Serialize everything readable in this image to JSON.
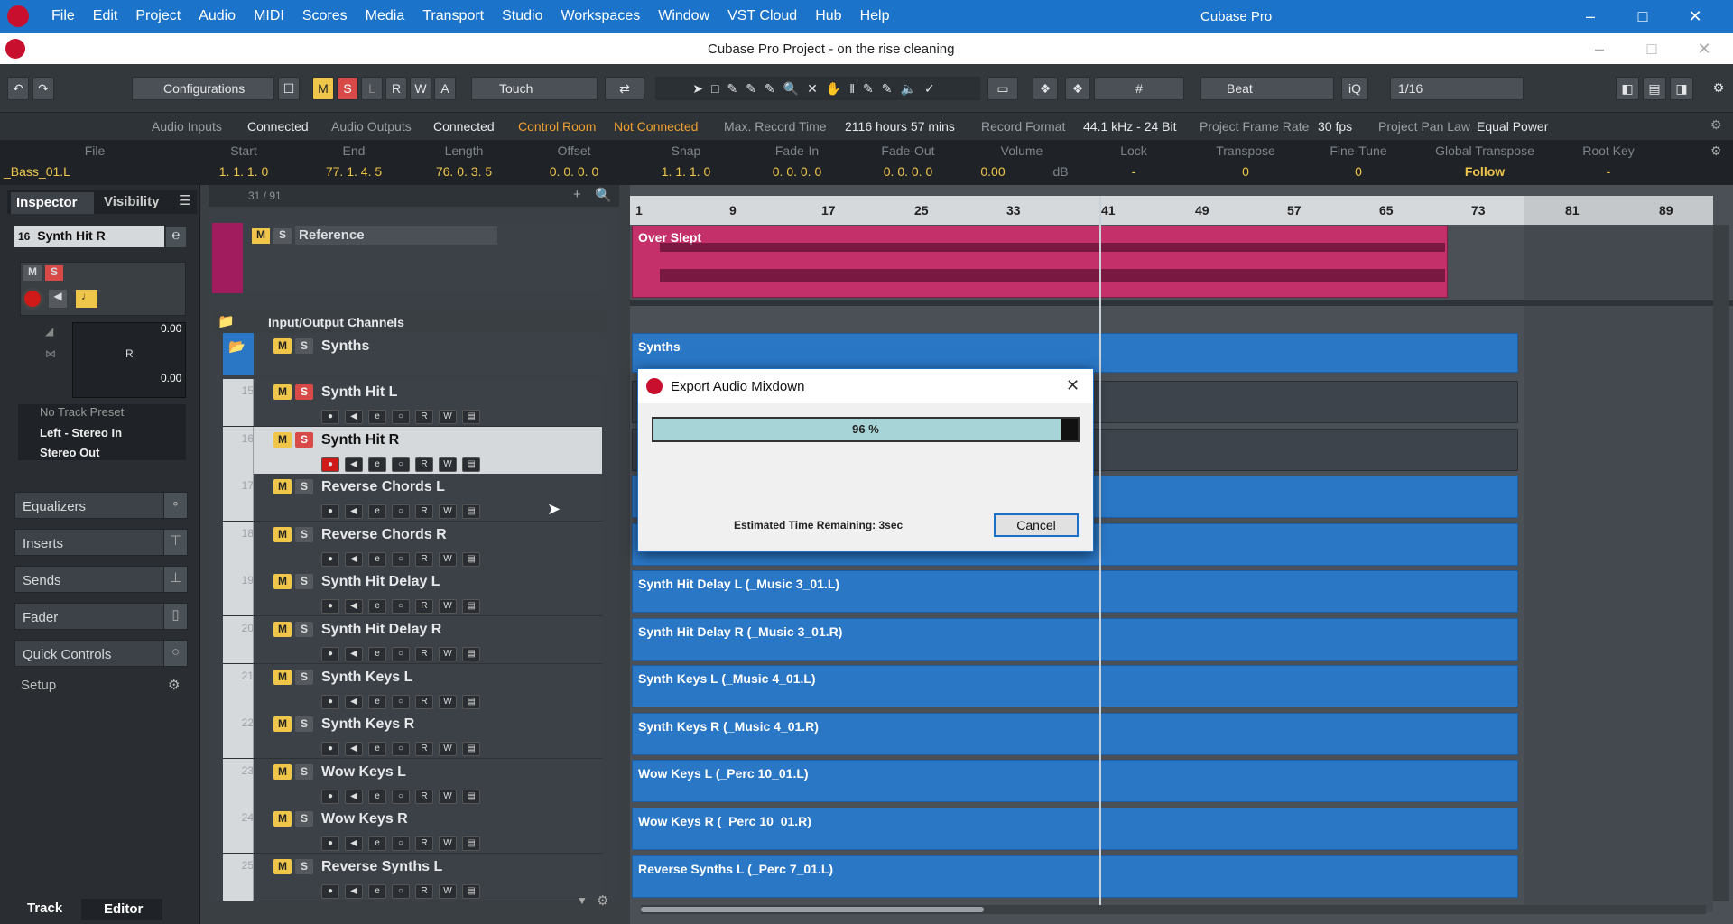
{
  "os": {
    "menu": [
      "File",
      "Edit",
      "Project",
      "Audio",
      "MIDI",
      "Scores",
      "Media",
      "Transport",
      "Studio",
      "Workspaces",
      "Window",
      "VST Cloud",
      "Hub",
      "Help"
    ],
    "app_title": "Cubase Pro"
  },
  "project": {
    "title": "Cubase Pro Project - on the rise cleaning"
  },
  "toolbar": {
    "configurations": "Configurations",
    "automation_mode": "Touch",
    "snap_type": "Beat",
    "quantize": "1/16",
    "iq": "iQ",
    "mode_buttons": [
      "M",
      "S",
      "L",
      "R",
      "W",
      "A"
    ]
  },
  "status": {
    "audio_inputs_label": "Audio Inputs",
    "audio_inputs_value": "Connected",
    "audio_outputs_label": "Audio Outputs",
    "audio_outputs_value": "Connected",
    "control_room_label": "Control Room",
    "control_room_value": "Not Connected",
    "max_record_label": "Max. Record Time",
    "max_record_value": "2116 hours 57 mins",
    "record_format_label": "Record Format",
    "record_format_value": "44.1 kHz - 24 Bit",
    "frame_rate_label": "Project Frame Rate",
    "frame_rate_value": "30 fps",
    "pan_law_label": "Project Pan Law",
    "pan_law_value": "Equal Power"
  },
  "infoline": {
    "headers": [
      "File",
      "Start",
      "End",
      "Length",
      "Offset",
      "Snap",
      "Fade-In",
      "Fade-Out",
      "Volume",
      "Lock",
      "Transpose",
      "Fine-Tune",
      "Global Transpose",
      "Root Key"
    ],
    "values": [
      "_Bass_01.L",
      "1. 1. 1.   0",
      "77. 1. 4.   5",
      "76. 0. 3.   5",
      "0. 0. 0.   0",
      "1. 1. 1.   0",
      "0. 0. 0.   0",
      "0. 0. 0.   0",
      "0.00",
      "-",
      "0",
      "0",
      "Follow",
      "-"
    ],
    "volume_unit": "dB"
  },
  "inspector": {
    "tab_inspector": "Inspector",
    "tab_visibility": "Visibility",
    "track_number": "16",
    "track_name": "Synth Hit R",
    "volume": "0.00",
    "pan_label": "R",
    "pan_value": "0.00",
    "preset": "No Track Preset",
    "input": "Left - Stereo In",
    "output": "Stereo Out",
    "sections": [
      "Equalizers",
      "Inserts",
      "Sends",
      "Fader",
      "Quick Controls"
    ],
    "setup": "Setup",
    "bottom_tab_track": "Track",
    "bottom_tab_editor": "Editor"
  },
  "tracklist": {
    "count": "31 / 91",
    "reference": "Reference",
    "folder": "Input/Output Channels",
    "synths": "Synths",
    "tracks": [
      {
        "num": "15",
        "name": "Synth Hit L",
        "solo": true
      },
      {
        "num": "16",
        "name": "Synth Hit R",
        "solo": true
      },
      {
        "num": "17",
        "name": "Reverse Chords L",
        "solo": false
      },
      {
        "num": "18",
        "name": "Reverse Chords R",
        "solo": false
      },
      {
        "num": "19",
        "name": "Synth Hit Delay L",
        "solo": false
      },
      {
        "num": "20",
        "name": "Synth Hit Delay R",
        "solo": false
      },
      {
        "num": "21",
        "name": "Synth Keys L",
        "solo": false
      },
      {
        "num": "22",
        "name": "Synth Keys R",
        "solo": false
      },
      {
        "num": "23",
        "name": "Wow Keys L",
        "solo": false
      },
      {
        "num": "24",
        "name": "Wow Keys R",
        "solo": false
      },
      {
        "num": "25",
        "name": "Reverse Synths L",
        "solo": false
      }
    ]
  },
  "ruler": [
    "1",
    "9",
    "17",
    "25",
    "33",
    "41",
    "49",
    "57",
    "65",
    "73",
    "81",
    "89"
  ],
  "events": {
    "reference": "Over Slept",
    "synths": "Synths",
    "items": [
      "Synth Hit Delay L (_Music 3_01.L)",
      "Synth Hit Delay R (_Music 3_01.R)",
      "Synth Keys L (_Music 4_01.L)",
      "Synth Keys R (_Music 4_01.R)",
      "Wow Keys L (_Perc 10_01.L)",
      "Wow Keys R (_Perc 10_01.R)",
      "Reverse Synths L (_Perc 7_01.L)"
    ]
  },
  "dialog": {
    "title": "Export Audio Mixdown",
    "progress_label": "96 %",
    "progress": 0.96,
    "remaining": "Estimated Time Remaining: 3sec",
    "cancel": "Cancel"
  }
}
